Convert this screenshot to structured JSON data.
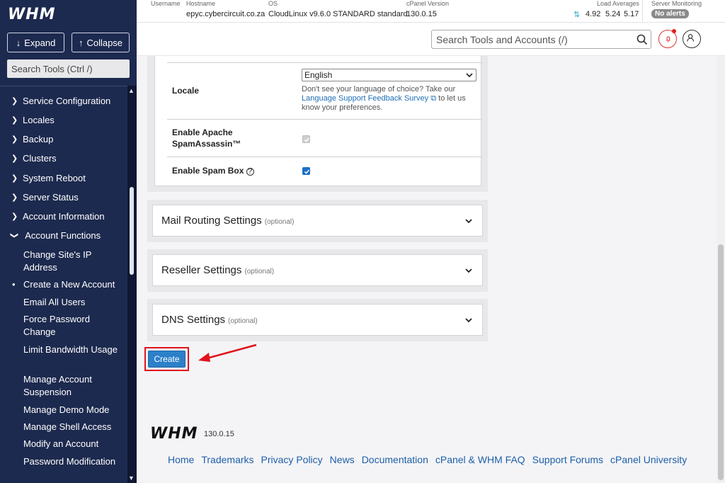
{
  "sidebar": {
    "logo": "WHM",
    "expand_label": "Expand",
    "collapse_label": "Collapse",
    "search_placeholder": "Search Tools (Ctrl /)",
    "items": [
      {
        "label": "Service Configuration"
      },
      {
        "label": "Locales"
      },
      {
        "label": "Backup"
      },
      {
        "label": "Clusters"
      },
      {
        "label": "System Reboot"
      },
      {
        "label": "Server Status"
      },
      {
        "label": "Account Information"
      },
      {
        "label": "Account Functions"
      }
    ],
    "sub_items": [
      {
        "label": "Change Site's IP Address"
      },
      {
        "label": "Create a New Account"
      },
      {
        "label": "Email All Users"
      },
      {
        "label": "Force Password Change"
      },
      {
        "label": "Limit Bandwidth Usage"
      },
      {
        "label": "Manage Account Suspension"
      },
      {
        "label": "Manage Demo Mode"
      },
      {
        "label": "Manage Shell Access"
      },
      {
        "label": "Modify an Account"
      },
      {
        "label": "Password Modification"
      }
    ]
  },
  "topbar": {
    "username_label": "Username",
    "hostname_label": "Hostname",
    "hostname": "epyc.cybercircuit.co.za",
    "os_label": "OS",
    "os": "CloudLinux v9.6.0 STANDARD standard",
    "cpanel_label": "cPanel Version",
    "cpanel_version": "130.0.15",
    "load_label": "Load Averages",
    "load_1": "4.92",
    "load_2": "5.24",
    "load_3": "5.17",
    "monitoring_label": "Server Monitoring",
    "alerts": "No alerts"
  },
  "header": {
    "search_placeholder": "Search Tools and Accounts (/)"
  },
  "form": {
    "locale_label": "Locale",
    "locale_value": "English",
    "locale_help_1": "Don't see your language of choice? Take our",
    "locale_help_link": "Language Support Feedback Survey",
    "locale_help_2": "to let us know your preferences.",
    "spamassassin_label": "Enable Apache SpamAssassin™",
    "spambox_label": "Enable Spam Box"
  },
  "sections": [
    {
      "title": "Mail Routing Settings",
      "optional": "(optional)"
    },
    {
      "title": "Reseller Settings",
      "optional": "(optional)"
    },
    {
      "title": "DNS Settings",
      "optional": "(optional)"
    }
  ],
  "create_label": "Create",
  "footer": {
    "logo": "WHM",
    "version": "130.0.15",
    "links": [
      "Home",
      "Trademarks",
      "Privacy Policy",
      "News",
      "Documentation",
      "cPanel & WHM FAQ",
      "Support Forums",
      "cPanel University"
    ]
  },
  "colors": {
    "sidebar_bg": "#1d2a4f",
    "primary": "#2c80c9",
    "highlight": "#e0141e",
    "link": "#1e5fa8"
  }
}
